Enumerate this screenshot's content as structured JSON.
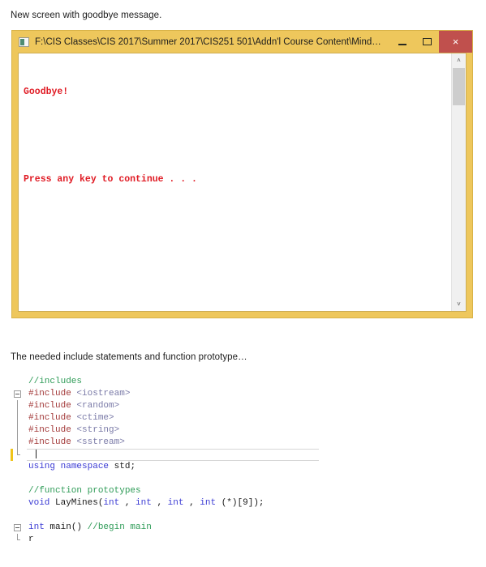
{
  "captions": {
    "top": "New screen with goodbye message.",
    "code": "The needed include statements and function prototype…"
  },
  "console_window": {
    "title": "F:\\CIS Classes\\CIS 2017\\Summer 2017\\CIS251 501\\Addn'l Course Content\\Mind…",
    "icon": "console-window-icon",
    "buttons": {
      "minimize": "─",
      "maximize": "❐",
      "close": "×"
    },
    "colors": {
      "frame": "#eec75c",
      "close_button": "#c0504d",
      "output_text": "#e01b24",
      "background": "#ffffff"
    },
    "output_lines": [
      "Goodbye!",
      "",
      "Press any key to continue . . ."
    ],
    "scrollbar": {
      "up_arrow": "˄",
      "down_arrow": "˅"
    }
  },
  "code_editor": {
    "colors": {
      "comment": "#2e9b57",
      "preprocessor": "#a33a3a",
      "header": "#7b7ba8",
      "keyword": "#3b3bd4",
      "plain": "#1a1a1a",
      "change_marker": "#f0c419"
    },
    "lines": [
      {
        "id": "comment-includes",
        "segments": [
          {
            "text": "//includes",
            "cls": "c-comment"
          }
        ]
      },
      {
        "id": "include-iostream",
        "segments": [
          {
            "text": "#include ",
            "cls": "c-pre"
          },
          {
            "text": "<iostream>",
            "cls": "c-header"
          }
        ]
      },
      {
        "id": "include-random",
        "segments": [
          {
            "text": "#include ",
            "cls": "c-pre"
          },
          {
            "text": "<random>",
            "cls": "c-header"
          }
        ]
      },
      {
        "id": "include-ctime",
        "segments": [
          {
            "text": "#include ",
            "cls": "c-pre"
          },
          {
            "text": "<ctime>",
            "cls": "c-header"
          }
        ]
      },
      {
        "id": "include-string",
        "segments": [
          {
            "text": "#include ",
            "cls": "c-pre"
          },
          {
            "text": "<string>",
            "cls": "c-header"
          }
        ]
      },
      {
        "id": "include-sstream",
        "segments": [
          {
            "text": "#include ",
            "cls": "c-pre"
          },
          {
            "text": "<sstream>",
            "cls": "c-header"
          }
        ]
      },
      {
        "id": "current-empty-line",
        "segments": []
      },
      {
        "id": "using-namespace",
        "segments": [
          {
            "text": "using",
            "cls": "c-kw"
          },
          {
            "text": " ",
            "cls": "c-plain"
          },
          {
            "text": "namespace",
            "cls": "c-kw"
          },
          {
            "text": " std;",
            "cls": "c-plain"
          }
        ]
      },
      {
        "id": "blank-1",
        "segments": []
      },
      {
        "id": "comment-function-prototypes",
        "segments": [
          {
            "text": "//function prototypes",
            "cls": "c-comment"
          }
        ]
      },
      {
        "id": "prototype-laymines",
        "segments": [
          {
            "text": "void",
            "cls": "c-kw"
          },
          {
            "text": " LayMines(",
            "cls": "c-plain"
          },
          {
            "text": "int",
            "cls": "c-kw"
          },
          {
            "text": " , ",
            "cls": "c-plain"
          },
          {
            "text": "int",
            "cls": "c-kw"
          },
          {
            "text": " , ",
            "cls": "c-plain"
          },
          {
            "text": "int",
            "cls": "c-kw"
          },
          {
            "text": " , ",
            "cls": "c-plain"
          },
          {
            "text": "int",
            "cls": "c-kw"
          },
          {
            "text": " (*)[9]);",
            "cls": "c-plain"
          }
        ]
      },
      {
        "id": "blank-2",
        "segments": []
      },
      {
        "id": "main-declaration",
        "segments": [
          {
            "text": "int",
            "cls": "c-kw"
          },
          {
            "text": " main() ",
            "cls": "c-plain"
          },
          {
            "text": "//begin main",
            "cls": "c-comment"
          }
        ]
      },
      {
        "id": "partial-brace",
        "segments": [
          {
            "text": "r",
            "cls": "c-plain"
          }
        ]
      }
    ]
  }
}
